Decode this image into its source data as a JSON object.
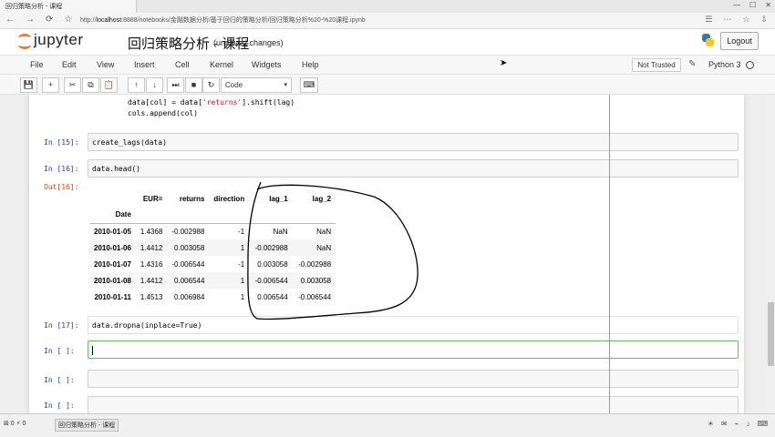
{
  "browser": {
    "tab_title": "回归策略分析 - 课程",
    "window_buttons": [
      "—",
      "☐",
      "✕"
    ],
    "url_prefix": "localhost",
    "url_rest": ":8888/notebooks/金融数据分析/基于回归的策略分析/回归策略分析%20-%20课程.ipynb",
    "addr_tail": "",
    "extension_icons": [
      "☰",
      "⋯",
      "☆",
      "⇩"
    ],
    "nav_icons": [
      "←",
      "→",
      "⟳",
      "☆"
    ]
  },
  "header": {
    "logo_text": "jupyter",
    "notebook_title": "回归策略分析 - 课程",
    "status": "(unsaved changes)",
    "logout_label": "Logout"
  },
  "menu": {
    "items": [
      "File",
      "Edit",
      "View",
      "Insert",
      "Cell",
      "Kernel",
      "Widgets",
      "Help"
    ],
    "trust_label": "Not Trusted",
    "pencil_icon": "✎",
    "kernel_name": "Python 3"
  },
  "toolbar": {
    "buttons": [
      "💾",
      "+",
      "✂",
      "⧉",
      "📋",
      "↑",
      "↓",
      "⏭",
      "■",
      "↻"
    ],
    "cell_type": "Code",
    "keyboard_icon": "⌨"
  },
  "cells": {
    "prev_code_line1": "data[col] = data['returns'].shift(lag)",
    "prev_code_line2": "cols.append(col)",
    "cell15_prompt": "In [15]:",
    "cell15_code": "create_lags(data)",
    "cell16_prompt": "In [16]:",
    "cell16_code": "data.head()",
    "out16_prompt": "Out[16]:",
    "cell17_prompt": "In [17]:",
    "cell17_code": "data.dropna(inplace=True)",
    "empty_prompt": "In [ ]:"
  },
  "dataframe": {
    "index_name": "Date",
    "columns": [
      "EUR=",
      "returns",
      "direction",
      "lag_1",
      "lag_2"
    ],
    "rows": [
      {
        "date": "2010-01-05",
        "values": [
          "1.4368",
          "-0.002988",
          "-1",
          "NaN",
          "NaN"
        ]
      },
      {
        "date": "2010-01-06",
        "values": [
          "1.4412",
          "0.003058",
          "1",
          "-0.002988",
          "NaN"
        ]
      },
      {
        "date": "2010-01-07",
        "values": [
          "1.4316",
          "-0.006544",
          "-1",
          "0.003058",
          "-0.002988"
        ]
      },
      {
        "date": "2010-01-08",
        "values": [
          "1.4412",
          "0.006544",
          "1",
          "-0.006544",
          "0.003058"
        ]
      },
      {
        "date": "2010-01-11",
        "values": [
          "1.4513",
          "0.006984",
          "1",
          "0.006544",
          "-0.006544"
        ]
      }
    ]
  },
  "taskbar": {
    "status_left": "⊞ 0 ⚡ 0",
    "task_label": "回归策略分析 - 课程",
    "tray_icons": [
      "☀",
      "✉",
      "⌁",
      "♪",
      "⌨"
    ]
  },
  "colors": {
    "logo_orange": "#f37726",
    "prompt_in": "#303f9f",
    "prompt_out": "#d84315",
    "active_cell_border": "#66bb6a",
    "annotation_ink": "#000000"
  }
}
